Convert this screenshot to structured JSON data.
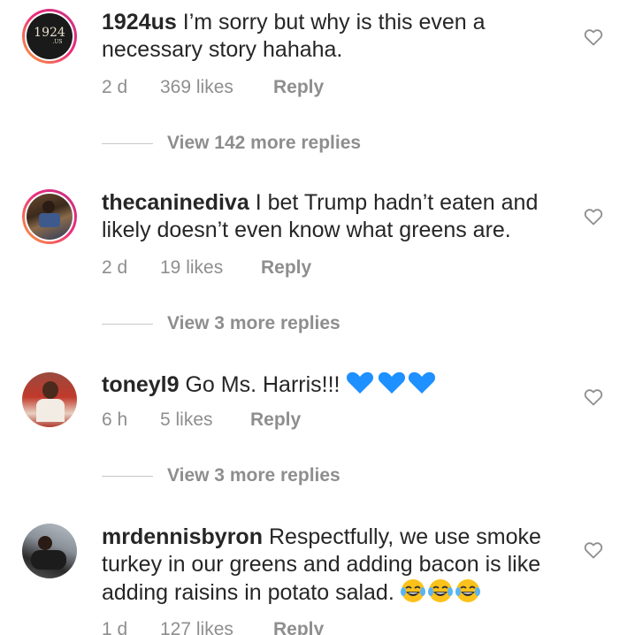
{
  "comments": [
    {
      "username": "1924us",
      "text": "I’m sorry but why is this even a necessary story hahaha.",
      "time": "2 d",
      "likes": "369 likes",
      "reply": "Reply",
      "view_replies": "View 142 more replies",
      "avatar_text": "1924",
      "avatar_subtext": ".US"
    },
    {
      "username": "thecaninediva",
      "text": "I bet Trump hadn’t eaten and likely doesn’t even know what greens are.",
      "time": "2 d",
      "likes": "19 likes",
      "reply": "Reply",
      "view_replies": "View 3 more replies"
    },
    {
      "username": "toneyl9",
      "text": "Go Ms. Harris!!!",
      "time": "6 h",
      "likes": "5 likes",
      "reply": "Reply",
      "view_replies": "View 3 more replies",
      "emoji": "blue-heart x3"
    },
    {
      "username": "mrdennisbyron",
      "text": "Respectfully, we use smoke turkey in our greens and adding bacon is like adding raisins in potato salad.",
      "time": "1 d",
      "likes": "127 likes",
      "reply": "Reply",
      "emoji": "laughing-face x3"
    }
  ],
  "icons": {
    "like": "heart-outline-icon"
  },
  "colors": {
    "primary_text": "#262626",
    "secondary_text": "#8e8e8e",
    "blue_heart": "#1e90ff",
    "story_ring_start": "#f9a33b",
    "story_ring_end": "#c13584"
  }
}
